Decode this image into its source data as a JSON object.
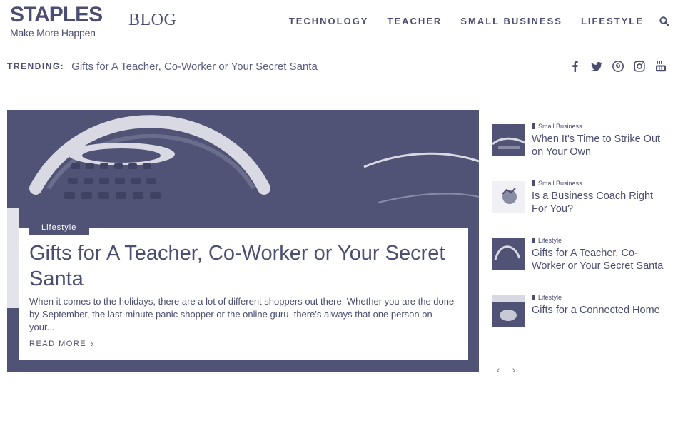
{
  "header": {
    "logo_word": "STAPLES",
    "logo_tagline": "Make More Happen",
    "blog_label": "BLOG",
    "nav": [
      "TECHNOLOGY",
      "TEACHER",
      "SMALL BUSINESS",
      "LIFESTYLE"
    ],
    "search_icon": "search-icon"
  },
  "trending": {
    "label": "TRENDING:",
    "link": "Gifts for A Teacher, Co-Worker or Your Secret Santa",
    "social_icons": [
      "facebook-icon",
      "twitter-icon",
      "pinterest-icon",
      "instagram-icon",
      "youtube-icon"
    ]
  },
  "hero": {
    "category": "Lifestyle",
    "title": "Gifts for A Teacher, Co-Worker or Your Secret Santa",
    "excerpt": "When it comes to the holidays, there are a lot of different shoppers out there. Whether you are the done-by-September, the last-minute panic shopper or the online guru, there's always that one person on your...",
    "read_more": "READ MORE"
  },
  "sidebar": {
    "items": [
      {
        "category": "Small Business",
        "title": "When It's Time to Strike Out on Your Own"
      },
      {
        "category": "Small Business",
        "title": "Is a Business Coach Right For You?"
      },
      {
        "category": "Lifestyle",
        "title": "Gifts for A Teacher, Co-Worker or Your Secret Santa"
      },
      {
        "category": "Lifestyle",
        "title": "Gifts for a Connected Home"
      }
    ]
  },
  "colors": {
    "primary": "#4b4e70",
    "hero_bg": "#505375",
    "background": "#ffffff"
  }
}
